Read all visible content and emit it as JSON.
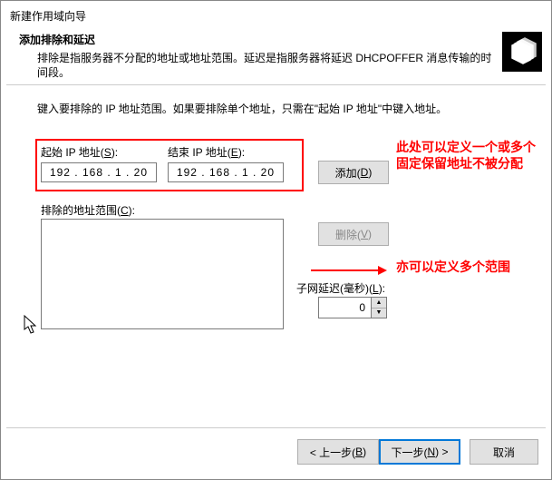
{
  "window": {
    "title": "新建作用域向导"
  },
  "header": {
    "heading": "添加排除和延迟",
    "description": "排除是指服务器不分配的地址或地址范围。延迟是指服务器将延迟 DHCPOFFER 消息传输的时间段。"
  },
  "instruction": "键入要排除的 IP 地址范围。如果要排除单个地址，只需在\"起始 IP 地址\"中键入地址。",
  "fields": {
    "start_label": "起始 IP 地址(S):",
    "start_value": "192 . 168 .   1  .  20",
    "end_label": "结束 IP 地址(E):",
    "end_value": "192 . 168 .   1  .  20",
    "add_button": "添加(D)",
    "excluded_label": "排除的地址范围(C):",
    "delete_button": "删除(V)",
    "delay_label": "子网延迟(毫秒)(L):",
    "delay_value": "0"
  },
  "annotations": {
    "note1": "此处可以定义一个或多个固定保留地址不被分配",
    "note2": "亦可以定义多个范围"
  },
  "footer": {
    "back": "< 上一步(B)",
    "next": "下一步(N) >",
    "cancel": "取消"
  },
  "icons": {
    "header_icon": "files-icon",
    "cursor": "mouse-cursor"
  }
}
